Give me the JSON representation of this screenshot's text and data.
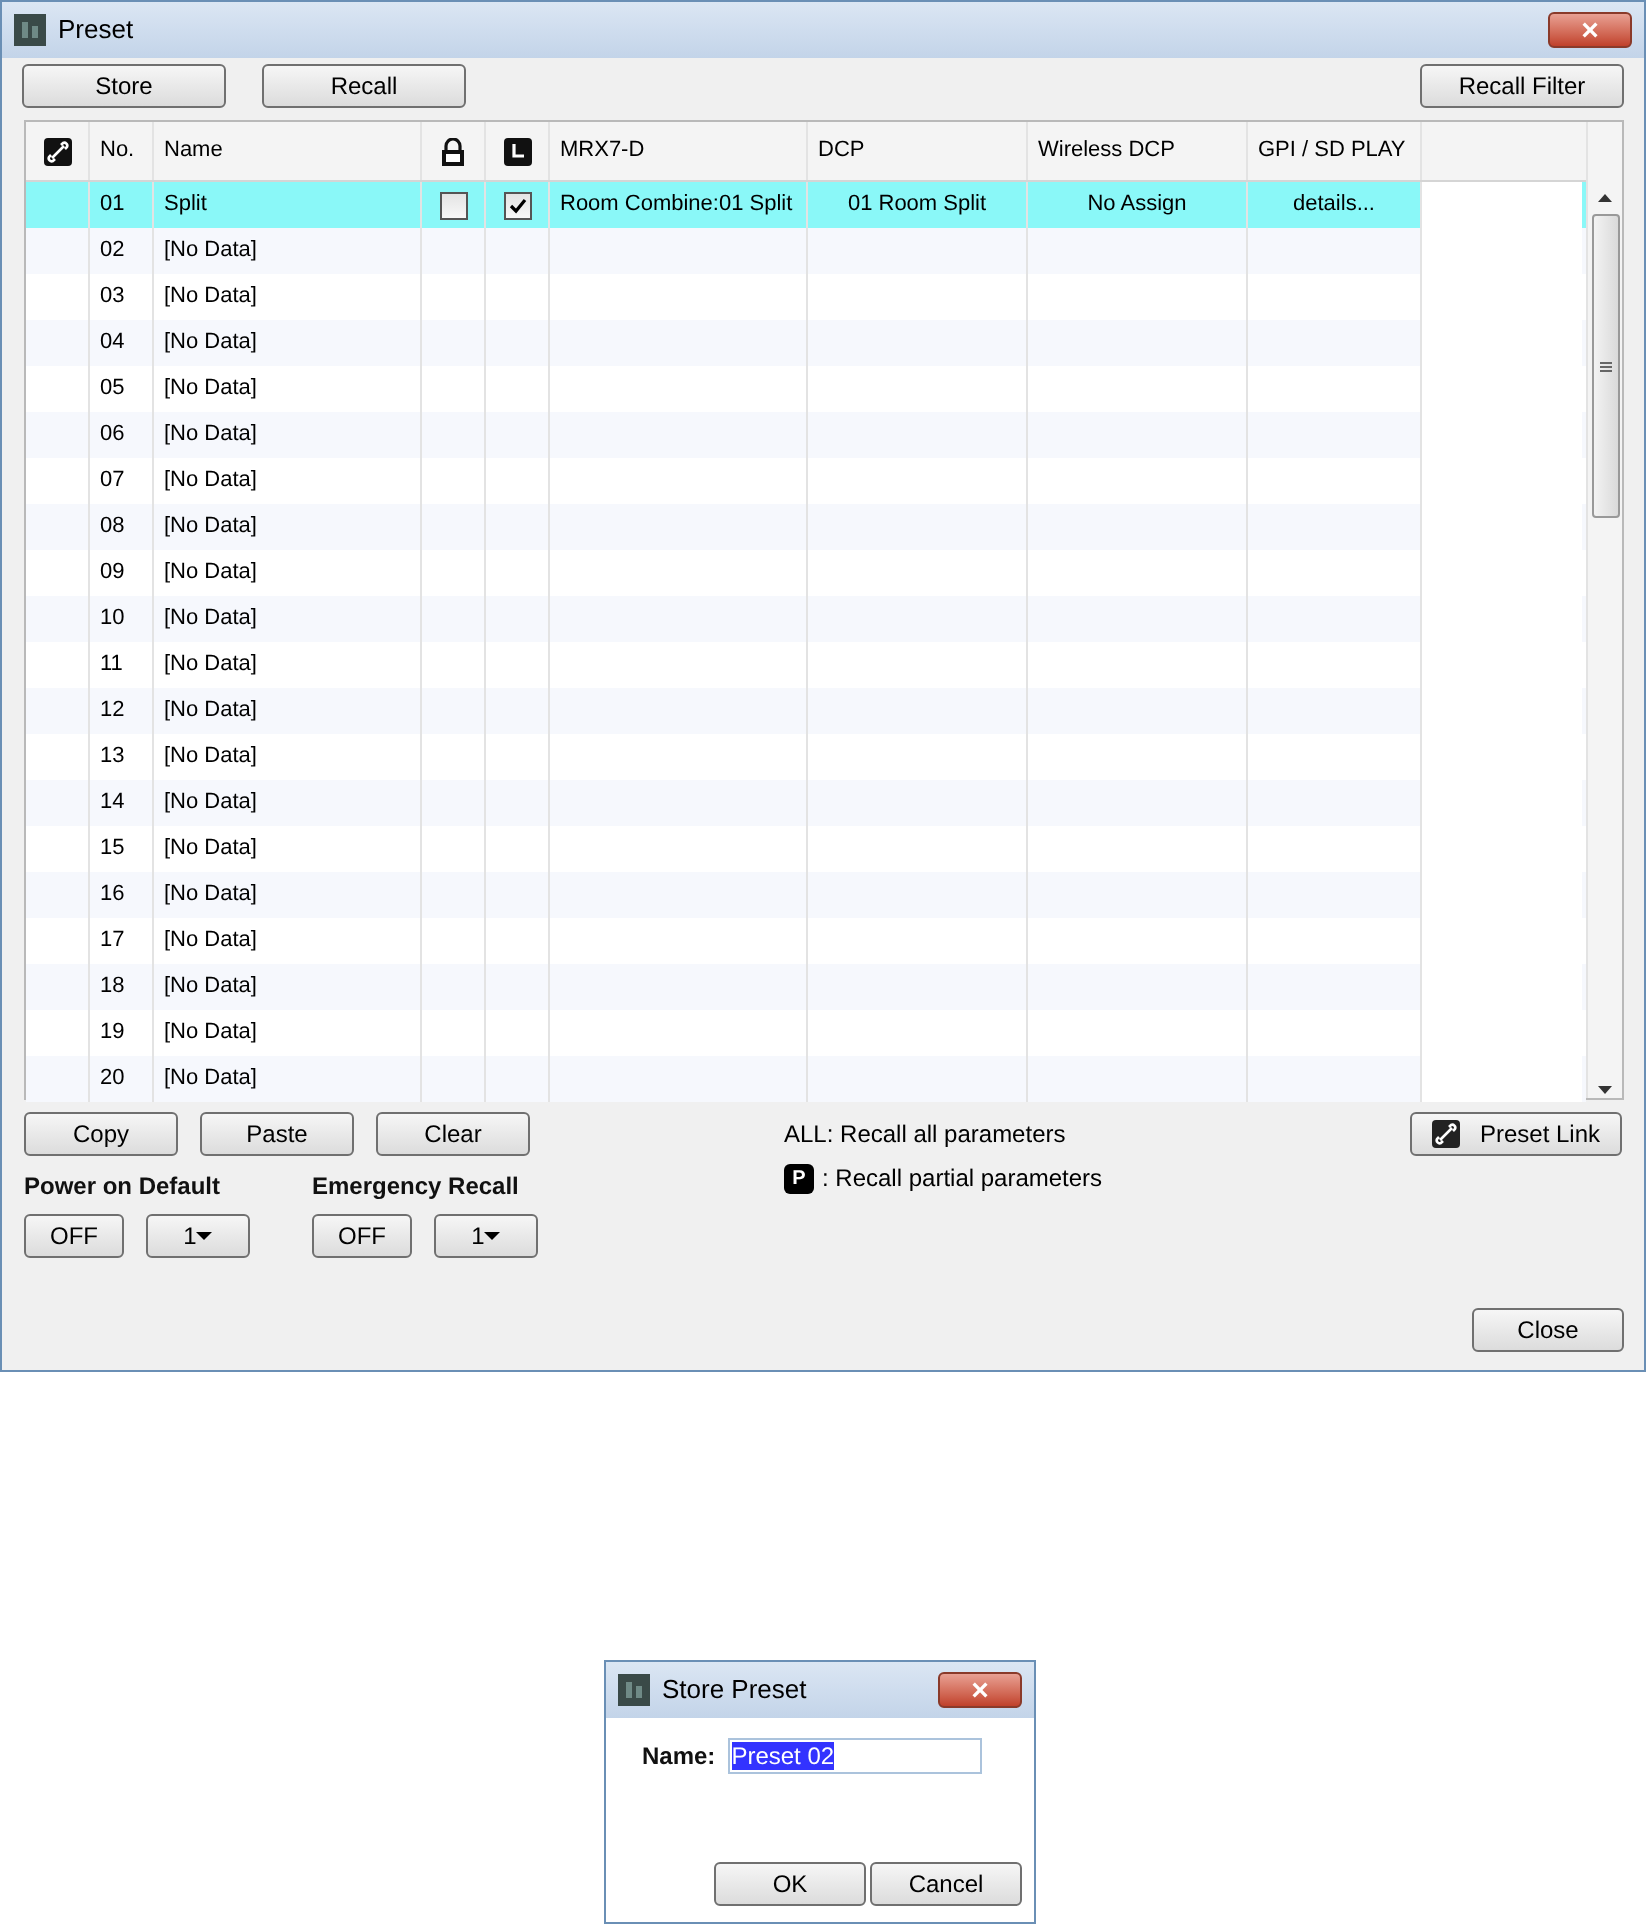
{
  "window": {
    "title": "Preset",
    "close": "×"
  },
  "toolbar": [
    "Store",
    "Recall"
  ],
  "recall_filter": "Recall Filter",
  "columns": [
    "No.",
    "Name",
    "MRX7-D",
    "DCP",
    "Wireless DCP",
    "GPI / SD PLAY"
  ],
  "rows": [
    {
      "no": "01",
      "name": "Split",
      "selected": true,
      "protect": false,
      "scheduled": true,
      "mrx7d": "Room Combine:01 Split",
      "dcp": "01 Room Split",
      "wireless_dcp": "No Assign",
      "gpi": "details..."
    },
    {
      "no": "02",
      "name": "[No Data]",
      "selected": false
    },
    {
      "no": "03",
      "name": "[No Data]",
      "selected": false
    },
    {
      "no": "04",
      "name": "[No Data]",
      "selected": false
    },
    {
      "no": "05",
      "name": "[No Data]",
      "selected": false
    },
    {
      "no": "06",
      "name": "[No Data]",
      "selected": false
    },
    {
      "no": "07",
      "name": "[No Data]",
      "selected": false
    },
    {
      "no": "08",
      "name": "[No Data]",
      "selected": false
    },
    {
      "no": "09",
      "name": "[No Data]",
      "selected": false
    },
    {
      "no": "10",
      "name": "[No Data]",
      "selected": false
    },
    {
      "no": "11",
      "name": "[No Data]",
      "selected": false
    },
    {
      "no": "12",
      "name": "[No Data]",
      "selected": false
    },
    {
      "no": "13",
      "name": "[No Data]",
      "selected": false
    },
    {
      "no": "14",
      "name": "[No Data]",
      "selected": false
    },
    {
      "no": "15",
      "name": "[No Data]",
      "selected": false
    },
    {
      "no": "16",
      "name": "[No Data]",
      "selected": false
    },
    {
      "no": "17",
      "name": "[No Data]",
      "selected": false
    },
    {
      "no": "18",
      "name": "[No Data]",
      "selected": false
    },
    {
      "no": "19",
      "name": "[No Data]",
      "selected": false
    },
    {
      "no": "20",
      "name": "[No Data]",
      "selected": false
    }
  ],
  "edit_buttons": [
    "Copy",
    "Paste",
    "Clear"
  ],
  "legend": {
    "all_key": "ALL",
    "all_text": ": Recall all parameters",
    "partial_key": "P",
    "partial_text": ": Recall partial parameters"
  },
  "preset_link": "Preset Link",
  "defaults": [
    {
      "label": "Power on Default",
      "toggle": "OFF",
      "value": "1"
    },
    {
      "label": "Emergency Recall",
      "toggle": "OFF",
      "value": "1"
    }
  ],
  "close_button": "Close",
  "dialog": {
    "title": "Store Preset",
    "close": "×",
    "name_label": "Name:",
    "name_value": "Preset 02",
    "buttons": [
      "OK",
      "Cancel"
    ]
  }
}
